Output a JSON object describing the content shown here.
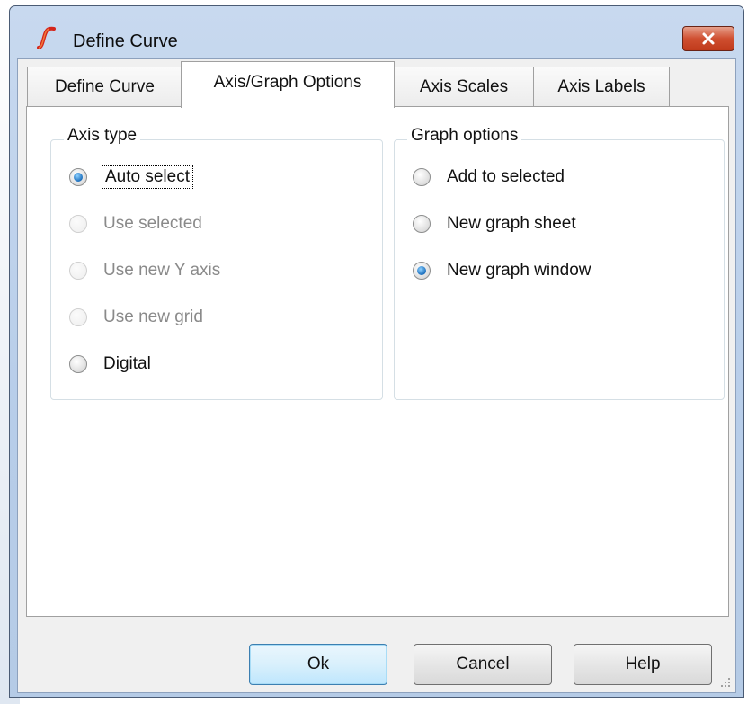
{
  "window": {
    "title": "Define Curve",
    "close_icon": "close-x-icon",
    "app_icon": "simetrix-curve-icon"
  },
  "tabs": [
    {
      "label": "Define Curve",
      "active": false
    },
    {
      "label": "Axis/Graph Options",
      "active": true
    },
    {
      "label": "Axis Scales",
      "active": false
    },
    {
      "label": "Axis Labels",
      "active": false
    }
  ],
  "axis_type": {
    "title": "Axis type",
    "options": [
      {
        "label": "Auto select",
        "checked": true,
        "enabled": true
      },
      {
        "label": "Use selected",
        "checked": false,
        "enabled": false
      },
      {
        "label": "Use new Y axis",
        "checked": false,
        "enabled": false
      },
      {
        "label": "Use new grid",
        "checked": false,
        "enabled": false
      },
      {
        "label": "Digital",
        "checked": false,
        "enabled": true
      }
    ]
  },
  "graph_options": {
    "title": "Graph options",
    "options": [
      {
        "label": "Add to selected",
        "checked": false,
        "enabled": true
      },
      {
        "label": "New graph sheet",
        "checked": false,
        "enabled": true
      },
      {
        "label": "New graph window",
        "checked": true,
        "enabled": true
      }
    ]
  },
  "buttons": {
    "ok": "Ok",
    "cancel": "Cancel",
    "help": "Help"
  },
  "colors": {
    "accent": "#3c7fb1",
    "close_button": "#c03a1b",
    "title_bar": "#b7cde9"
  }
}
